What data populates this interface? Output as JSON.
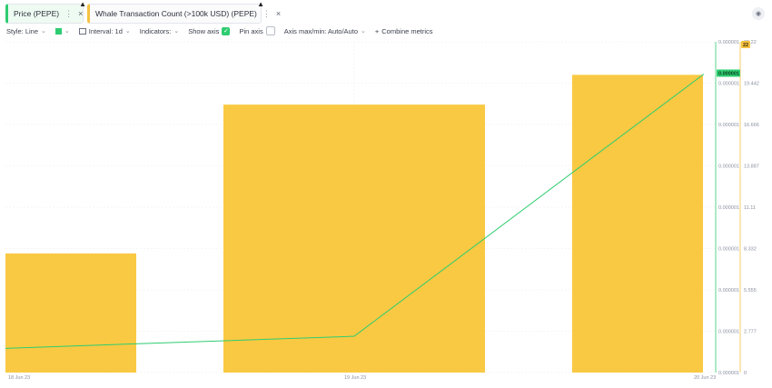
{
  "tabs": [
    {
      "label": "Price (PEPE)",
      "kebab": "⋮",
      "close": "×",
      "color": "#2ecc71"
    },
    {
      "label": "Whale Transaction Count (>100k USD) (PEPE)",
      "kebab": "⋮",
      "close": "×",
      "color": "#f5c242"
    }
  ],
  "toolbar": {
    "style": "Style: Line",
    "interval": "Interval: 1d",
    "indicators": "Indicators:",
    "show_axis": "Show axis",
    "pin_axis": "Pin axis",
    "axis_maxmin": "Axis max/min: Auto/Auto",
    "combine_metrics": "Combine metrics"
  },
  "chart_data": {
    "type": "bar",
    "x": [
      "18 Jun 23",
      "19 Jun 23",
      "20 Jun 23"
    ],
    "series": [
      {
        "name": "Whale Transaction Count (>100k USD) (PEPE)",
        "type": "bar",
        "color": "#f9c943",
        "values": [
          8,
          18,
          20
        ],
        "axis": "right",
        "axis_ticks": [
          "0",
          "2.777",
          "5.555",
          "8.332",
          "11.11",
          "13.887",
          "16.666",
          "19.442",
          "22.22"
        ],
        "ylim": [
          0,
          22.22
        ],
        "last_value_label": "22"
      },
      {
        "name": "Price (PEPE)",
        "type": "line",
        "color": "#2ecc71",
        "values": [
          1.06e-06,
          1.09e-06,
          1.74e-06
        ],
        "axis": "left",
        "axis_ticks": [
          "0.000001",
          "0.000001",
          "0.000001",
          "0.000001",
          "0.000001",
          "0.000001",
          "0.000001",
          "0.000001",
          "0.000001"
        ],
        "last_value_label": "0.000001"
      }
    ],
    "grid": true
  }
}
